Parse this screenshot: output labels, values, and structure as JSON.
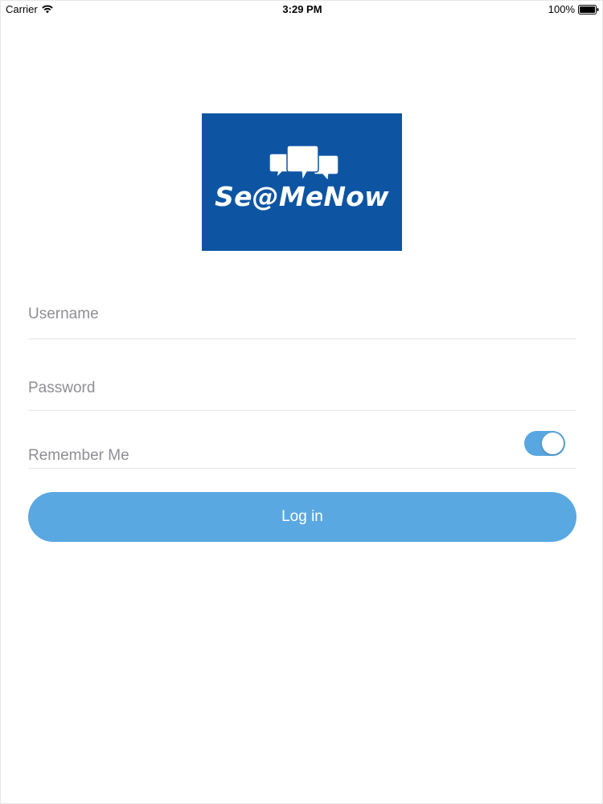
{
  "status_bar": {
    "carrier": "Carrier",
    "time": "3:29 PM",
    "battery": "100%"
  },
  "logo": {
    "text": "Se@MeNow",
    "background_color": "#0d55a3"
  },
  "form": {
    "username_placeholder": "Username",
    "username_value": "",
    "password_placeholder": "Password",
    "password_value": "",
    "remember_label": "Remember Me",
    "remember_on": true,
    "login_label": "Log in"
  },
  "colors": {
    "accent": "#5aa8e1",
    "placeholder": "#8e8e93",
    "divider": "#e4e4e4"
  },
  "icons": {
    "wifi": "wifi-icon",
    "battery": "battery-icon",
    "logo_graphic": "speech-bubbles-icon"
  }
}
